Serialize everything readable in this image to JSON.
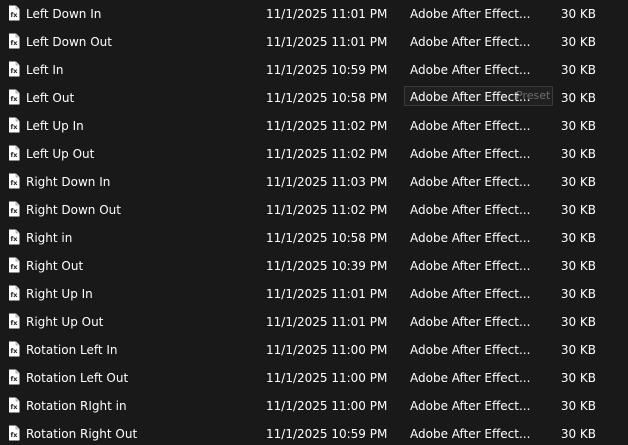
{
  "files": [
    {
      "name": "Left Down In",
      "date": "11/1/2025 11:01 PM",
      "type": "Adobe After Effect...",
      "size": "30 KB",
      "icon": "after-effects-preset-icon"
    },
    {
      "name": "Left Down Out",
      "date": "11/1/2025 11:01 PM",
      "type": "Adobe After Effect...",
      "size": "30 KB",
      "icon": "after-effects-preset-icon"
    },
    {
      "name": "Left In",
      "date": "11/1/2025 10:59 PM",
      "type": "Adobe After Effect...",
      "size": "30 KB",
      "icon": "after-effects-preset-icon"
    },
    {
      "name": "Left Out",
      "date": "11/1/2025 10:58 PM",
      "type": "Adobe After Effect...",
      "size": "30 KB",
      "icon": "after-effects-preset-icon"
    },
    {
      "name": "Left Up In",
      "date": "11/1/2025 11:02 PM",
      "type": "Adobe After Effect...",
      "size": "30 KB",
      "icon": "after-effects-preset-icon"
    },
    {
      "name": "Left Up Out",
      "date": "11/1/2025 11:02 PM",
      "type": "Adobe After Effect...",
      "size": "30 KB",
      "icon": "after-effects-preset-icon"
    },
    {
      "name": "Right Down In",
      "date": "11/1/2025 11:03 PM",
      "type": "Adobe After Effect...",
      "size": "30 KB",
      "icon": "after-effects-preset-icon"
    },
    {
      "name": "Right Down Out",
      "date": "11/1/2025 11:02 PM",
      "type": "Adobe After Effect...",
      "size": "30 KB",
      "icon": "after-effects-preset-icon"
    },
    {
      "name": "Right in",
      "date": "11/1/2025 10:58 PM",
      "type": "Adobe After Effect...",
      "size": "30 KB",
      "icon": "after-effects-preset-icon"
    },
    {
      "name": "Right Out",
      "date": "11/1/2025 10:39 PM",
      "type": "Adobe After Effect...",
      "size": "30 KB",
      "icon": "after-effects-preset-icon"
    },
    {
      "name": "Right Up In",
      "date": "11/1/2025 11:01 PM",
      "type": "Adobe After Effect...",
      "size": "30 KB",
      "icon": "after-effects-preset-icon"
    },
    {
      "name": "Right Up Out",
      "date": "11/1/2025 11:01 PM",
      "type": "Adobe After Effect...",
      "size": "30 KB",
      "icon": "after-effects-preset-icon"
    },
    {
      "name": "Rotation Left In",
      "date": "11/1/2025 11:00 PM",
      "type": "Adobe After Effect...",
      "size": "30 KB",
      "icon": "after-effects-preset-icon"
    },
    {
      "name": "Rotation Left Out",
      "date": "11/1/2025 11:00 PM",
      "type": "Adobe After Effect...",
      "size": "30 KB",
      "icon": "after-effects-preset-icon"
    },
    {
      "name": "Rotation RIght in",
      "date": "11/1/2025 11:00 PM",
      "type": "Adobe After Effect...",
      "size": "30 KB",
      "icon": "after-effects-preset-icon"
    },
    {
      "name": "Rotation Right Out",
      "date": "11/1/2025 10:59 PM",
      "type": "Adobe After Effect...",
      "size": "30 KB",
      "icon": "after-effects-preset-icon"
    }
  ],
  "tooltip": {
    "visible_text": "Adobe After Effect...",
    "overflow_text": "Preset"
  },
  "colors": {
    "background": "#191919",
    "text": "#ffffff",
    "tooltip_background": "#202020",
    "tooltip_border": "#3a3a3a",
    "tooltip_text": "#6e6e6e"
  }
}
